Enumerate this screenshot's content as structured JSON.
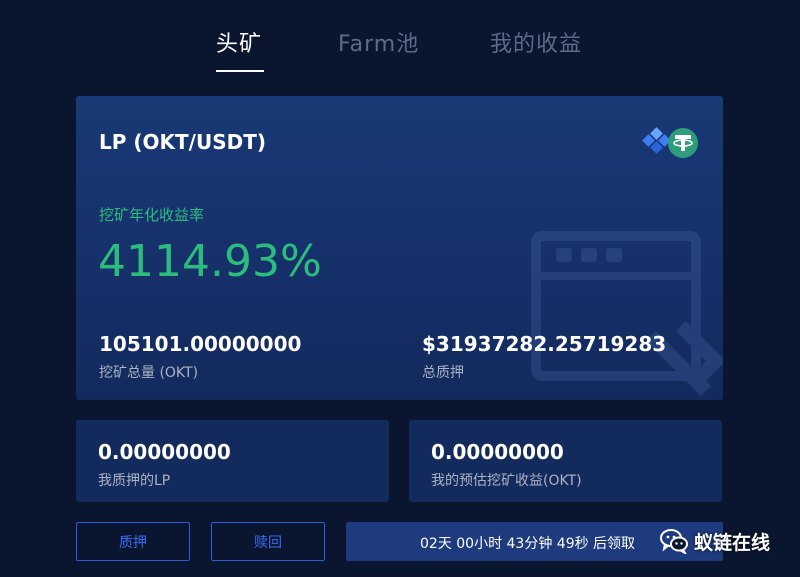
{
  "tabs": [
    {
      "label": "头矿",
      "active": true
    },
    {
      "label": "Farm池",
      "active": false
    },
    {
      "label": "我的收益",
      "active": false
    }
  ],
  "pool": {
    "title": "LP (OKT/USDT)",
    "token_icons": [
      "okex-chain-icon",
      "tether-icon"
    ],
    "apy_label": "挖矿年化收益率",
    "apy_value": "4114.93%",
    "total_mined_value": "105101.00000000",
    "total_mined_label": "挖矿总量 (OKT)",
    "total_staked_value": "$31937282.25719283",
    "total_staked_label": "总质押"
  },
  "my_lp": {
    "value": "0.00000000",
    "label": "我质押的LP"
  },
  "my_estimate": {
    "value": "0.00000000",
    "label": "我的预估挖矿收益(OKT)"
  },
  "actions": {
    "stake_label": "质押",
    "redeem_label": "赎回",
    "countdown_text": "02天 00小时 43分钟 49秒 后领取"
  },
  "watermark": {
    "icon": "wechat-icon",
    "text": "蚁链在线"
  },
  "colors": {
    "background": "#0a1530",
    "card": "#16306a",
    "accent_green": "#2bbd7e",
    "accent_blue": "#2d5bd9"
  }
}
